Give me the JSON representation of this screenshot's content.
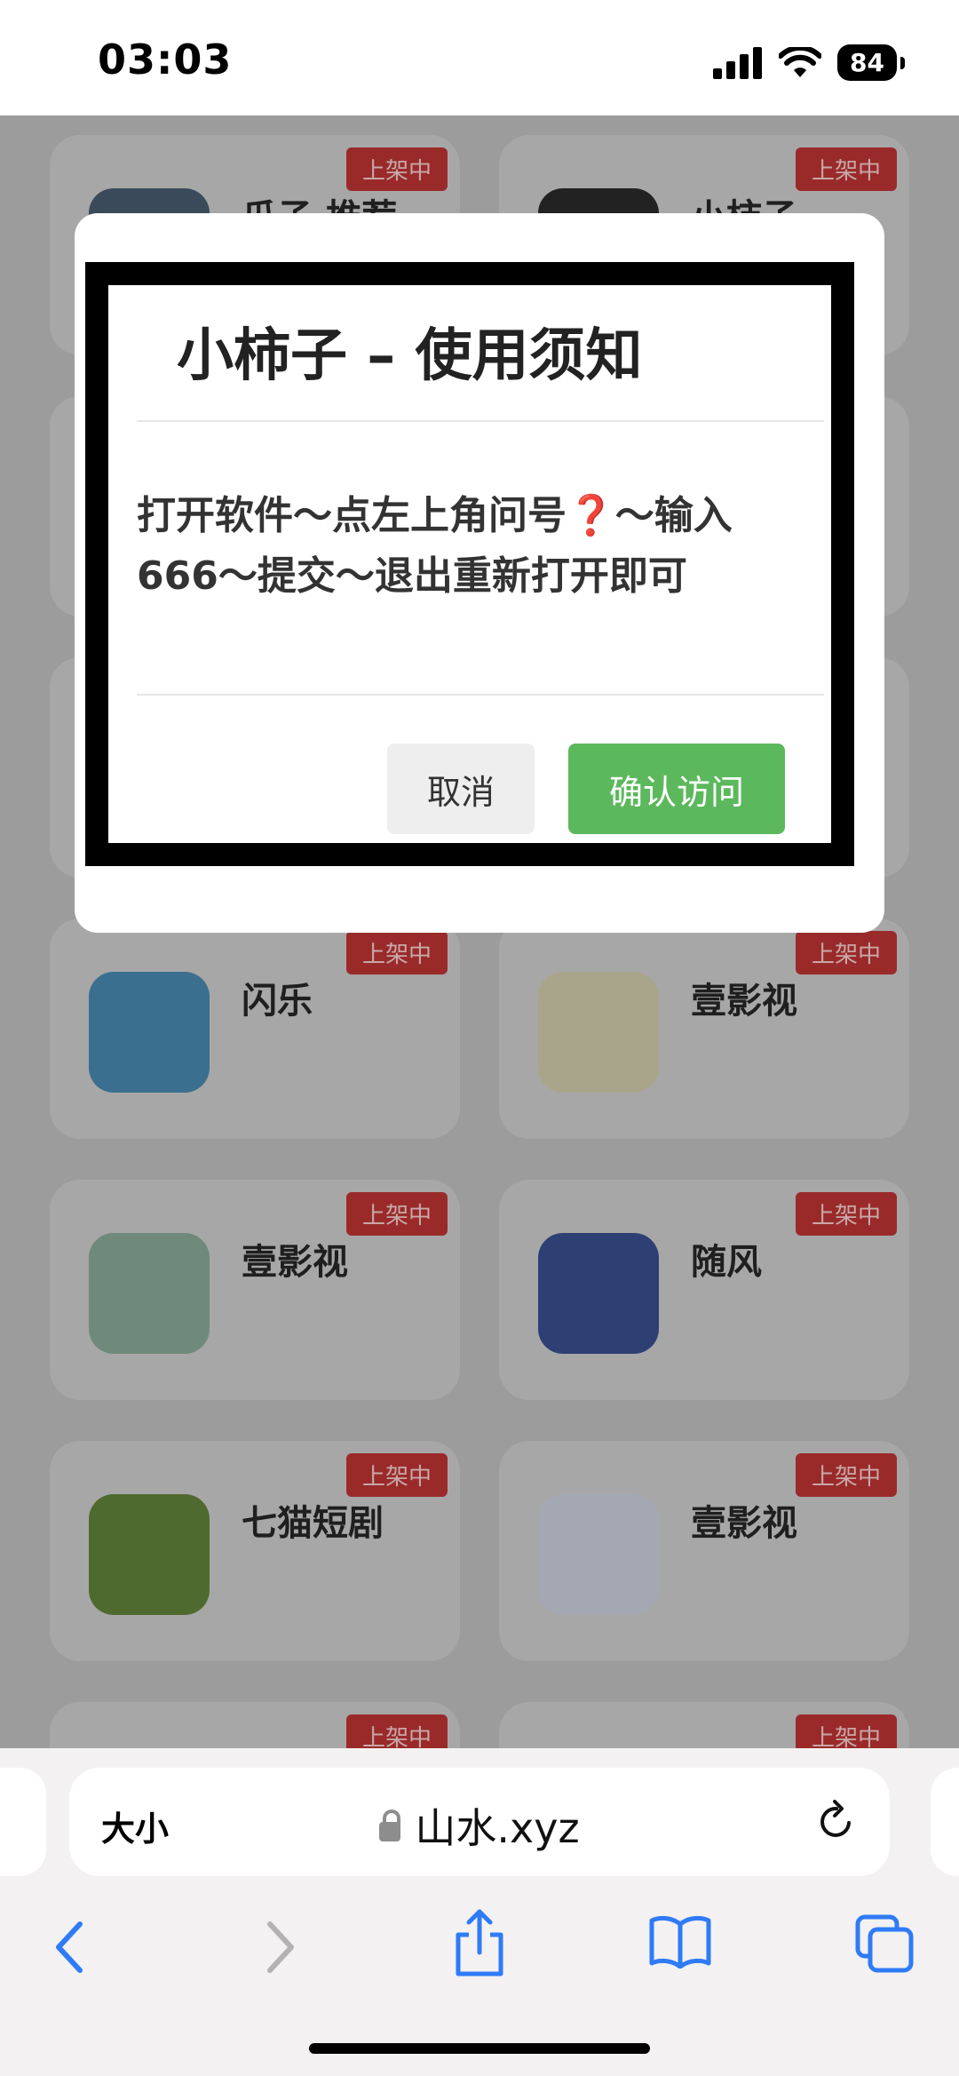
{
  "status_bar": {
    "time": "03:03",
    "battery": "84"
  },
  "background_cards": [
    {
      "name": "瓜子·推荐",
      "badge": "上架中",
      "icon_color": "#3a4a5a"
    },
    {
      "name": "小柿子",
      "badge": "上架中",
      "icon_color": "#222222"
    },
    {
      "name": "闪乐",
      "badge": "上架中",
      "icon_color": "#3b6f8f"
    },
    {
      "name": "壹影视",
      "badge": "上架中",
      "icon_color": "#a9a58a"
    },
    {
      "name": "壹影视",
      "badge": "上架中",
      "icon_color": "#6f8a7a"
    },
    {
      "name": "随风",
      "badge": "上架中",
      "icon_color": "#2d3f73"
    },
    {
      "name": "七猫短剧",
      "badge": "上架中",
      "icon_color": "#4f6a2f"
    },
    {
      "name": "壹影视",
      "badge": "上架中",
      "icon_color": "#a3a8b3"
    }
  ],
  "bottom_badges": [
    "上架中",
    "上架中"
  ],
  "modal": {
    "title": "小柿子 – 使用须知",
    "body_line1": "打开软件～点左上角问号",
    "body_qmark": "❓",
    "body_line1_end": "～输入",
    "body_line2": "666～提交～退出重新打开即可",
    "cancel_label": "取消",
    "confirm_label": "确认访问"
  },
  "browser": {
    "text_size_label": "大小",
    "url": "山水.xyz"
  },
  "colors": {
    "confirm": "#5cb85c",
    "badge": "#9a2a2a",
    "ios_blue": "#2f7bf6"
  }
}
